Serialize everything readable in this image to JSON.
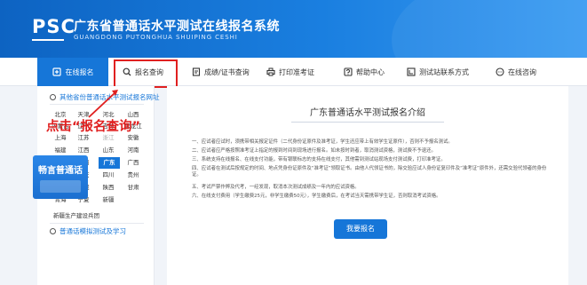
{
  "header": {
    "logo": "PSC",
    "title": "广东省普通话水平测试在线报名系统",
    "subtitle": "GUANGDONG PUTONGHUA SHUIPING CESHI"
  },
  "nav": {
    "items": [
      {
        "label": "在线报名",
        "icon": "register-icon",
        "active": true
      },
      {
        "label": "报名查询",
        "icon": "search-icon",
        "active": false
      },
      {
        "label": "成绩/证书查询",
        "icon": "certificate-icon",
        "active": false
      },
      {
        "label": "打印准考证",
        "icon": "print-icon",
        "active": false
      },
      {
        "label": "帮助中心",
        "icon": "help-icon",
        "active": false
      },
      {
        "label": "测试站联系方式",
        "icon": "contact-icon",
        "active": false
      },
      {
        "label": "在线咨询",
        "icon": "chat-icon",
        "active": false
      }
    ],
    "highlight_color": "#e02020"
  },
  "sidebar": {
    "other_provinces_heading": "其他省份普通话水平测试报名网址",
    "provinces": [
      [
        "北京",
        "天津",
        "河北",
        "山西"
      ],
      [
        "内蒙古",
        "辽宁",
        "吉林",
        "黑龙江"
      ],
      [
        "上海",
        "江苏",
        "浙江",
        "安徽"
      ],
      [
        "福建",
        "江西",
        "山东",
        "河南"
      ],
      [
        "湖北",
        "湖南",
        "广东",
        "广西"
      ],
      [
        "海南",
        "重庆",
        "四川",
        "贵州"
      ],
      [
        "云南",
        "西藏",
        "陕西",
        "甘肃"
      ],
      [
        "青海",
        "宁夏",
        "新疆",
        ""
      ]
    ],
    "selected_province": "广东",
    "newland": "新疆生产建设兵团",
    "practice_heading": "普通话模拟测试及学习",
    "promo_text": "畅言普通话"
  },
  "annotation": {
    "text": "点击“报名查询”"
  },
  "main": {
    "title": "广东普通话水平测试报名介绍",
    "notices": [
      "一、应试者应试时，须携带相关报定证件（二代身份证原件及准考证，学生还应带上有效学生证原件），否则不予报名测试。",
      "二、应试者应严格按照准考证上指定的报到时间到现场进行报名。如未按时到者，取消测试资格，测试费不予退还。",
      "三、系统支持在线报名、在线支付功能，带有银联标志的支持在线支付，其他需到测试站现场支付测试费，打印准考证。",
      "四、应试者在测试后按规定的时间、地点凭身份证原件及“准考证”领取证书。由他人代领证书的，除交验应试人身份证复印件及“准考证”原件外，还需交验代领者的身份证。",
      "五、考试严禁作弊及代考，一经发现，取消本次测试成绩及一年内的应试资格。",
      "六、在线支付费用（学生缴费25元，非学生缴费50元），学生缴费后，在考试当天需携带学生证，否则取消考试资格。"
    ],
    "register_button": "我要报名"
  }
}
